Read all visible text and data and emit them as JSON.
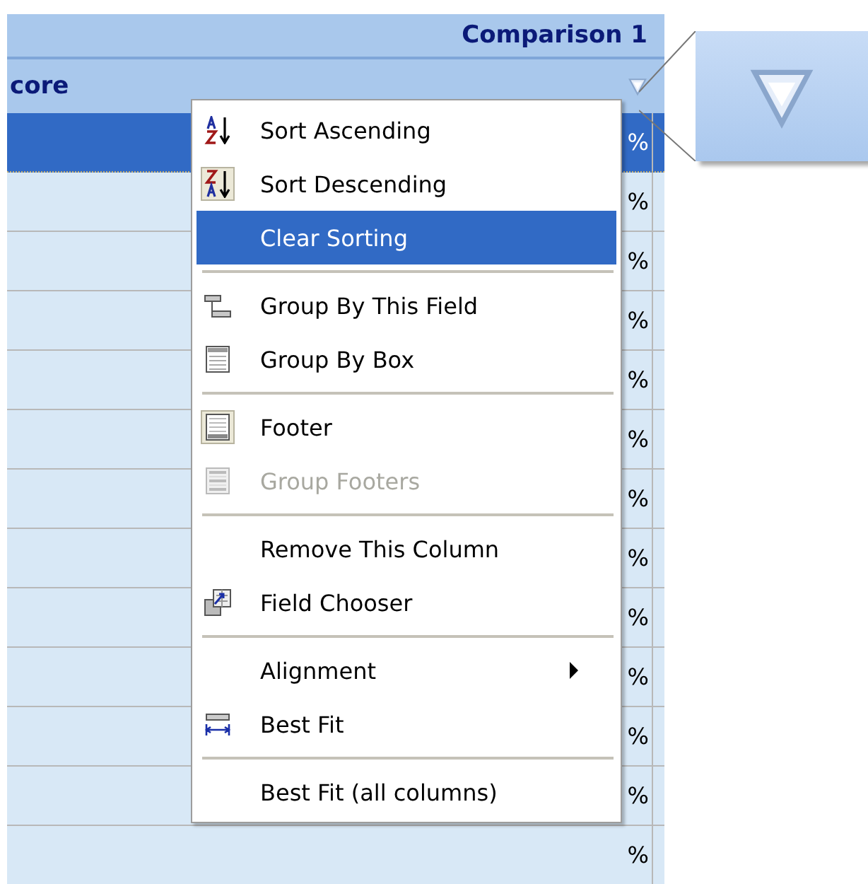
{
  "grid": {
    "band_title": "Comparison 1",
    "column_header": "core",
    "rows": [
      {
        "value": "%",
        "selected": true
      },
      {
        "value": "%",
        "selected": false
      },
      {
        "value": "%",
        "selected": false
      },
      {
        "value": "%",
        "selected": false
      },
      {
        "value": "%",
        "selected": false
      },
      {
        "value": "%",
        "selected": false
      },
      {
        "value": "%",
        "selected": false
      },
      {
        "value": "%",
        "selected": false
      },
      {
        "value": "%",
        "selected": false
      },
      {
        "value": "%",
        "selected": false
      },
      {
        "value": "%",
        "selected": false
      },
      {
        "value": "%",
        "selected": false
      },
      {
        "value": "%",
        "selected": false
      }
    ]
  },
  "context_menu": {
    "groups": [
      [
        {
          "label": "Sort Ascending",
          "selected": false,
          "checked": false,
          "disabled": false
        },
        {
          "label": "Sort Descending",
          "selected": false,
          "checked": true,
          "disabled": false
        },
        {
          "label": "Clear Sorting",
          "selected": true,
          "checked": false,
          "disabled": false
        }
      ],
      [
        {
          "label": "Group By This Field",
          "selected": false,
          "checked": false,
          "disabled": false
        },
        {
          "label": "Group By Box",
          "selected": false,
          "checked": false,
          "disabled": false
        }
      ],
      [
        {
          "label": "Footer",
          "selected": false,
          "checked": true,
          "disabled": false
        },
        {
          "label": "Group Footers",
          "selected": false,
          "checked": false,
          "disabled": true
        }
      ],
      [
        {
          "label": "Remove This Column",
          "selected": false,
          "checked": false,
          "disabled": false
        },
        {
          "label": "Field Chooser",
          "selected": false,
          "checked": false,
          "disabled": false
        }
      ],
      [
        {
          "label": "Alignment",
          "selected": false,
          "checked": false,
          "disabled": false,
          "submenu": true
        },
        {
          "label": "Best Fit",
          "selected": false,
          "checked": false,
          "disabled": false
        }
      ],
      [
        {
          "label": "Best Fit (all columns)",
          "selected": false,
          "checked": false,
          "disabled": false
        }
      ]
    ]
  }
}
